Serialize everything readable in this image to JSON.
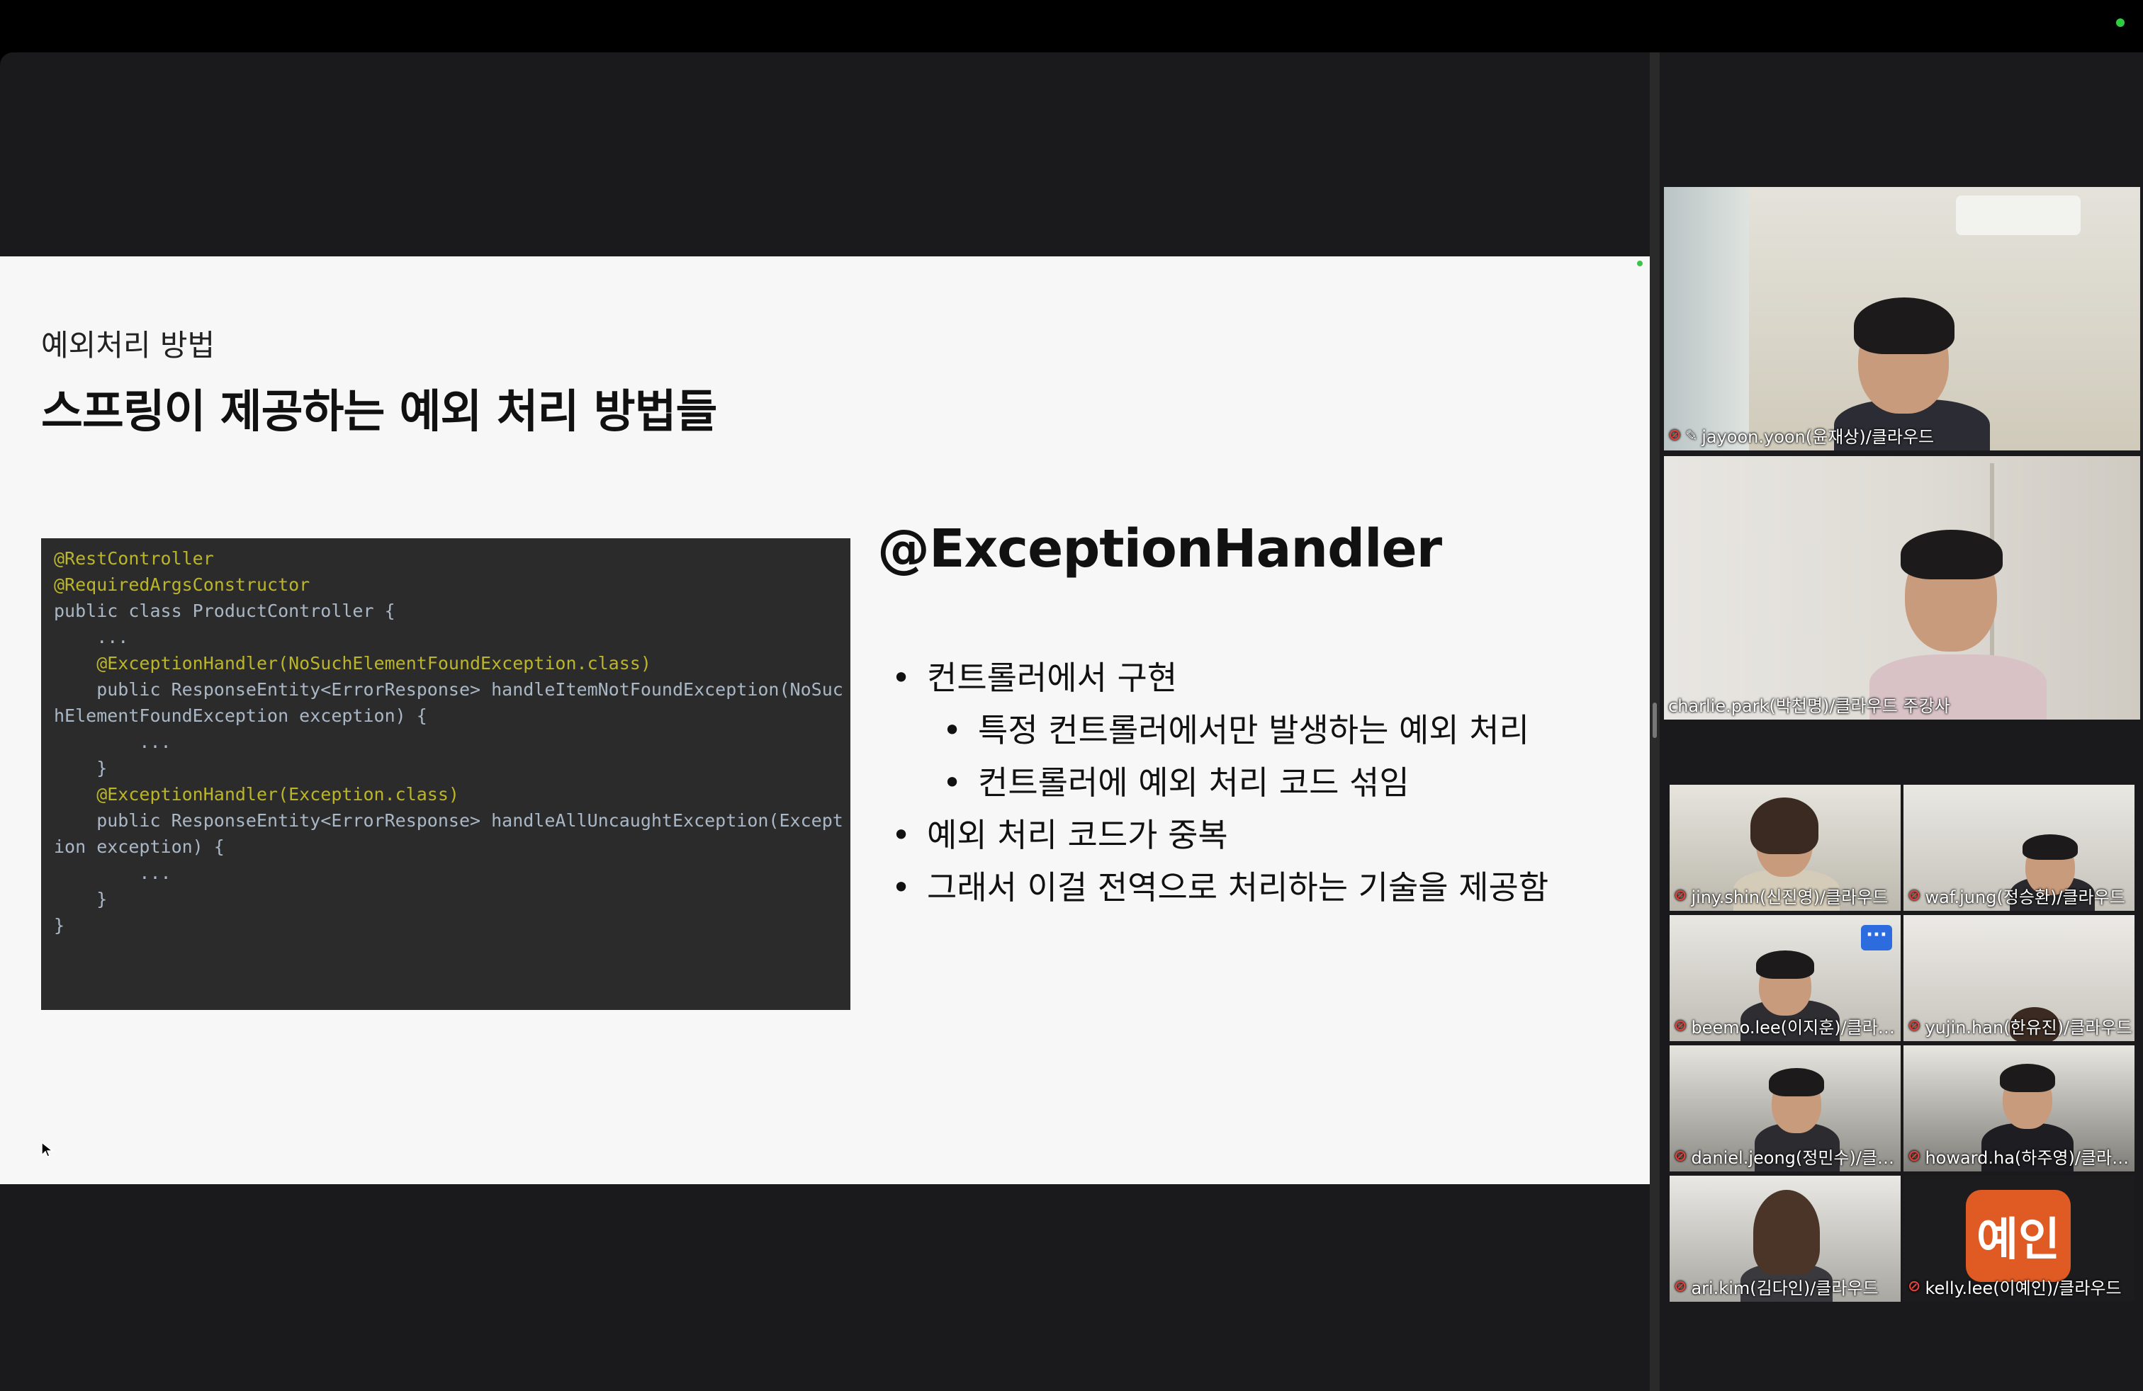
{
  "slide": {
    "eyebrow": "예외처리 방법",
    "title": "스프링이 제공하는 예외 처리 방법들",
    "code_lines": [
      "@RestController",
      "@RequiredArgsConstructor",
      "public class ProductController {",
      "",
      "    ...",
      "",
      "    @ExceptionHandler(NoSuchElementFoundException.class)",
      "    public ResponseEntity<ErrorResponse> handleItemNotFoundException(NoSuc",
      "hElementFoundException exception) {",
      "        ...",
      "    }",
      "",
      "    @ExceptionHandler(Exception.class)",
      "    public ResponseEntity<ErrorResponse> handleAllUncaughtException(Except",
      "ion exception) {",
      "        ...",
      "    }",
      "}"
    ],
    "heading": "@ExceptionHandler",
    "bullets": [
      "컨트롤러에서 구현",
      "특정 컨트롤러에서만 발생하는 예외 처리",
      "컨트롤러에 예외 처리 코드 섞임",
      "예외 처리 코드가 중복",
      "그래서 이걸 전역으로 처리하는 기술을 제공함"
    ]
  },
  "participants": {
    "speaker_top": "jayoon.yoon(윤재상)/클라우드",
    "speaker_active": "charlie.park(박천명)/클라우드 주강사",
    "grid": [
      "jiny.shin(신진영)/클라우드",
      "waf.jung(정승환)/클라우드",
      "beemo.lee(이지훈)/클라…",
      "yujin.han(한유진)/클라우드",
      "daniel.jeong(정민수)/클…",
      "howard.ha(하주영)/클라…",
      "ari.kim(김다인)/클라우드",
      "kelly.lee(이예인)/클라우드"
    ],
    "avatar_initials": "예인",
    "more_label": "···"
  },
  "icons": {
    "mute": "mic-muted-icon",
    "pin": "pin-icon"
  },
  "colors": {
    "active_speaker_border": "#35c759",
    "mute_icon": "#e0413a",
    "avatar_bg": "#e05a24"
  }
}
